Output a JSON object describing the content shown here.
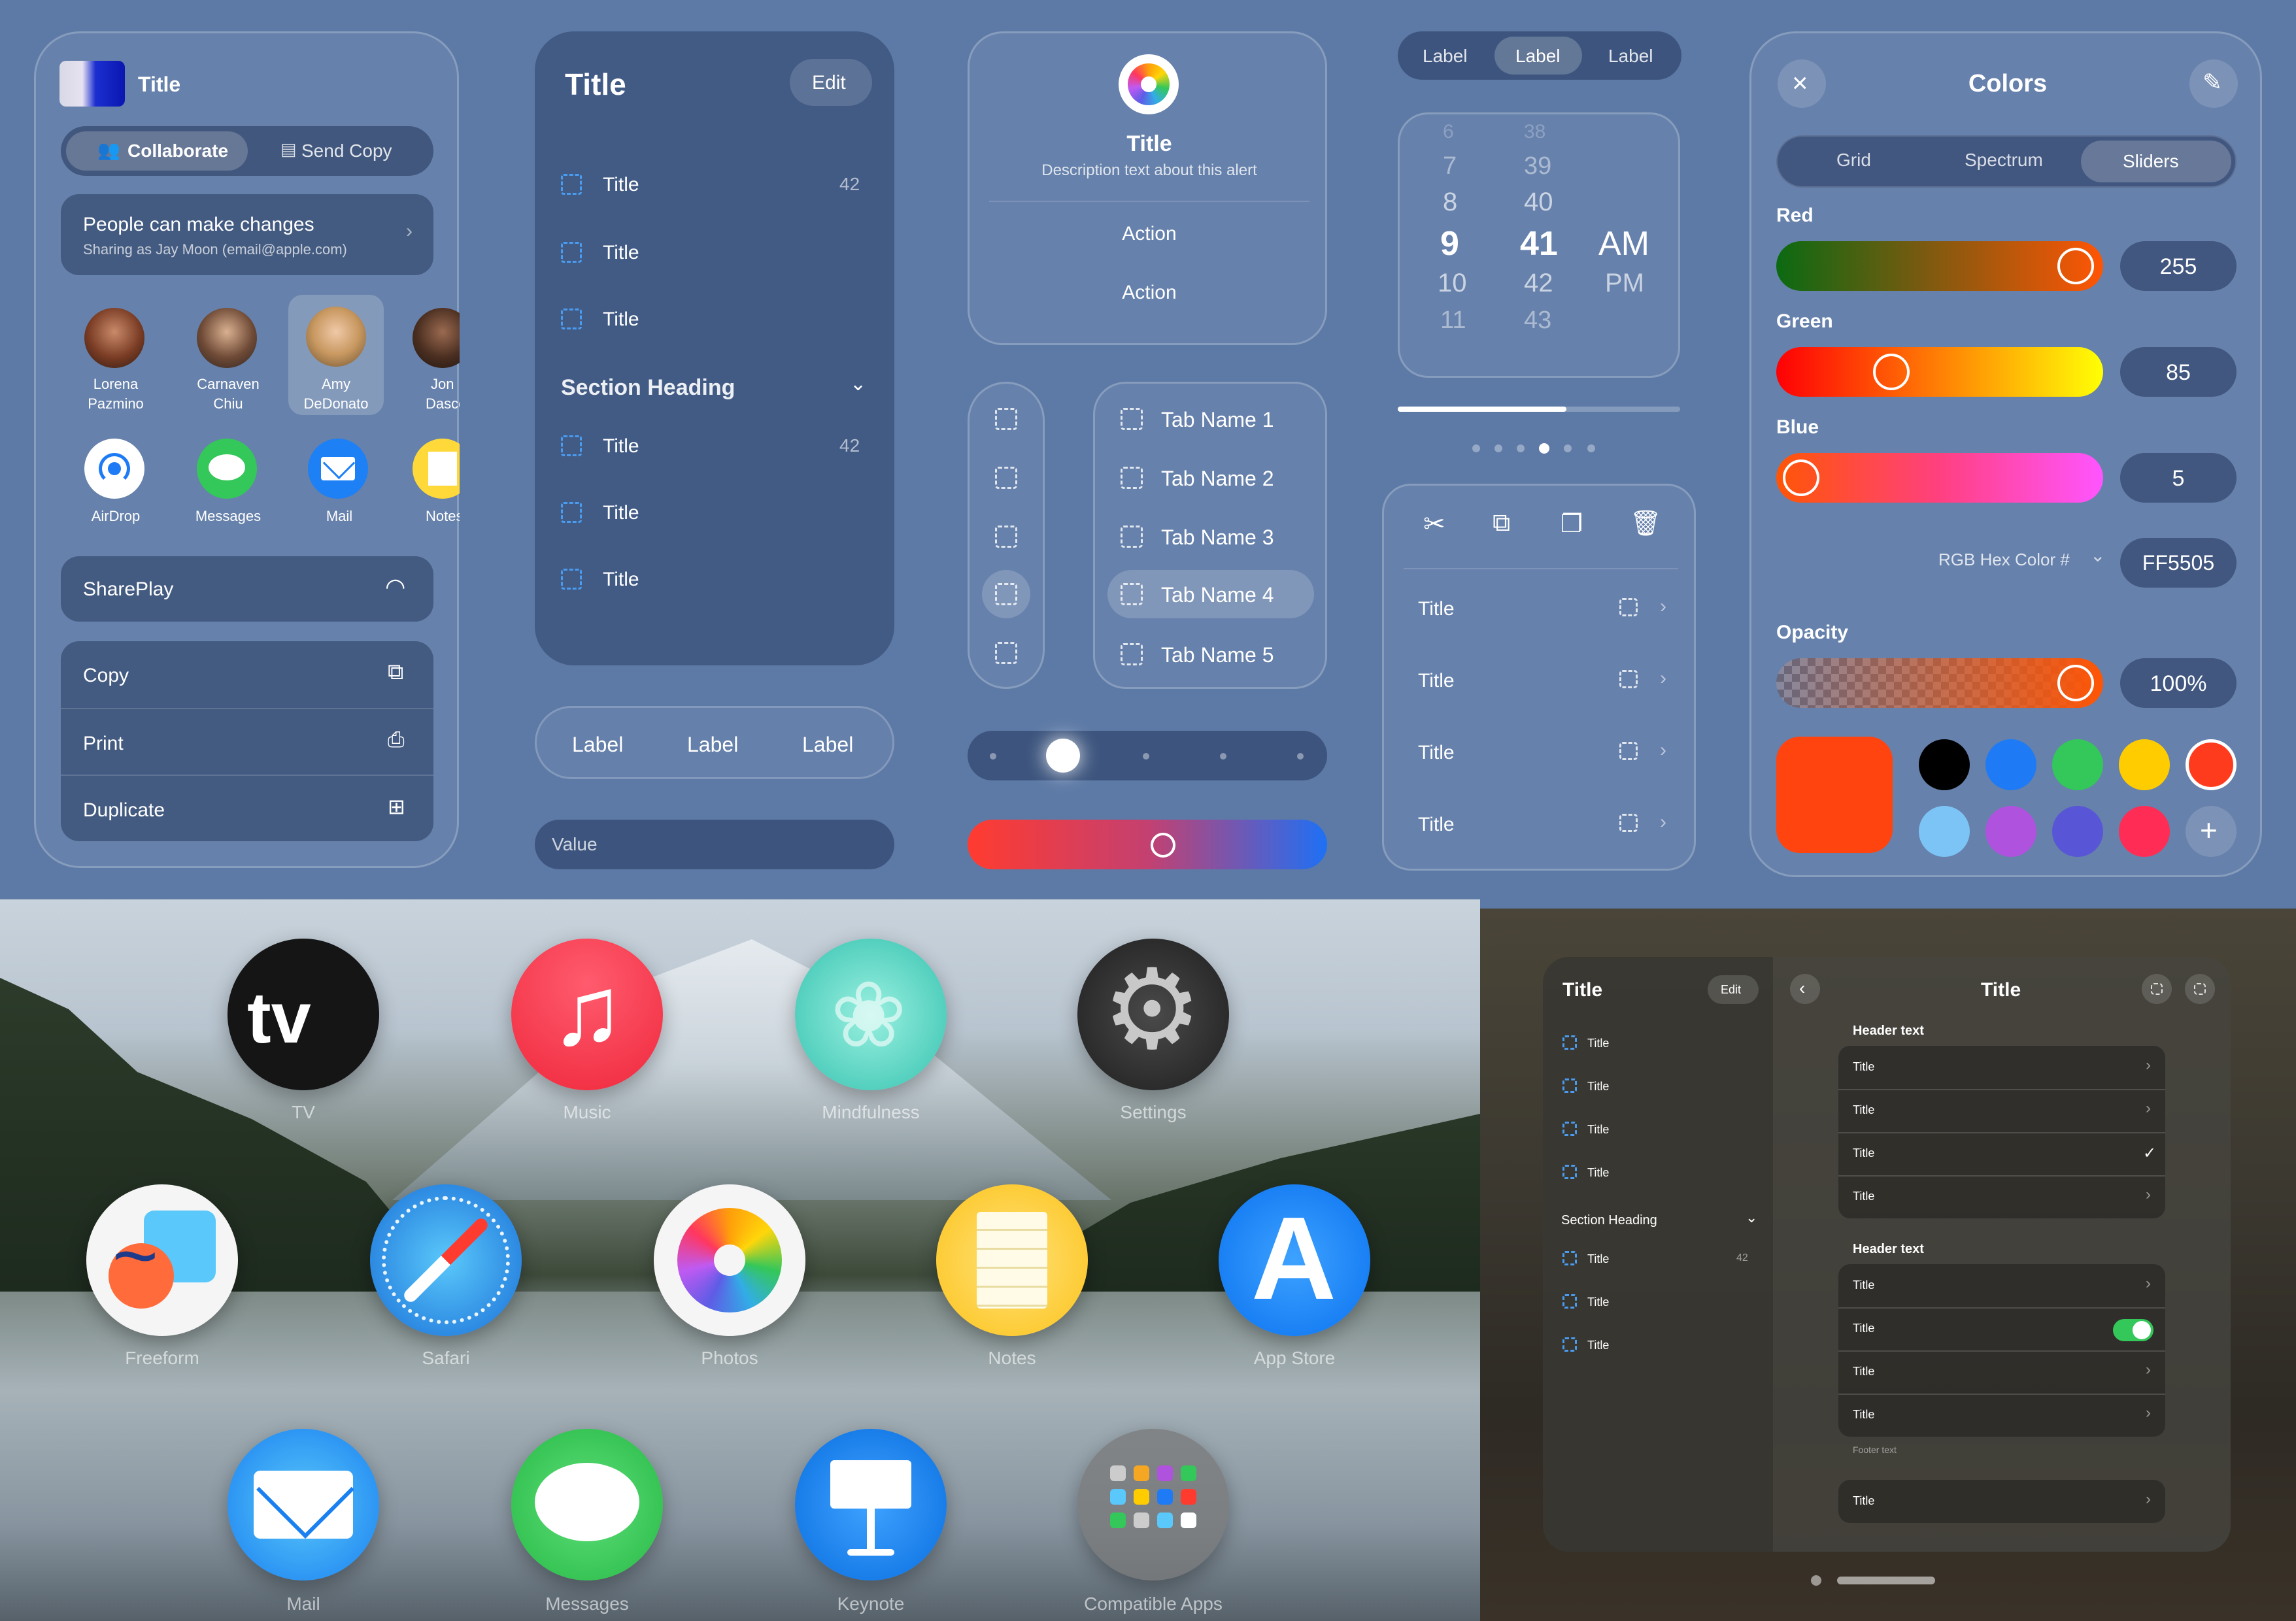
{
  "share": {
    "title": "Title",
    "collaborate": "Collaborate",
    "send_copy": "Send Copy",
    "permission_title": "People can make changes",
    "permission_sub": "Sharing as Jay Moon (email@apple.com)",
    "people": [
      {
        "line1": "Lorena",
        "line2": "Pazmino"
      },
      {
        "line1": "Carnaven",
        "line2": "Chiu"
      },
      {
        "line1": "Amy",
        "line2": "DeDonato"
      },
      {
        "line1": "Jon",
        "line2": "Dasco"
      }
    ],
    "apps": [
      "AirDrop",
      "Messages",
      "Mail",
      "Notes"
    ],
    "shareplay": "SharePlay",
    "actions": [
      "Copy",
      "Print",
      "Duplicate"
    ]
  },
  "list": {
    "title": "Title",
    "edit": "Edit",
    "rows": [
      "Title",
      "Title",
      "Title"
    ],
    "count": "42",
    "section": "Section Heading",
    "rows2": [
      "Title",
      "Title",
      "Title"
    ],
    "count2": "42"
  },
  "segmented_labels": [
    "Label",
    "Label",
    "Label"
  ],
  "value_field": "Value",
  "alert": {
    "title": "Title",
    "description": "Description text about this alert",
    "action1": "Action",
    "action2": "Action"
  },
  "tabs": [
    "Tab Name 1",
    "Tab Name 2",
    "Tab Name 3",
    "Tab Name 4",
    "Tab Name 5"
  ],
  "top_segment": [
    "Label",
    "Label",
    "Label"
  ],
  "picker": {
    "hours": [
      "7",
      "8",
      "9",
      "10",
      "11"
    ],
    "minutes": [
      "39",
      "40",
      "41",
      "42",
      "43"
    ],
    "ampm": [
      "AM",
      "PM"
    ]
  },
  "menu_rows": [
    "Title",
    "Title",
    "Title",
    "Title"
  ],
  "colors": {
    "title": "Colors",
    "tabs": [
      "Grid",
      "Spectrum",
      "Sliders"
    ],
    "red_label": "Red",
    "red_value": "255",
    "green_label": "Green",
    "green_value": "85",
    "blue_label": "Blue",
    "blue_value": "5",
    "hex_label": "RGB Hex Color #",
    "hex_value": "FF5505",
    "opacity_label": "Opacity",
    "opacity_value": "100%",
    "current_color": "#ff4410",
    "swatches": [
      "#000000",
      "#1e7bf5",
      "#34c759",
      "#ffcc00",
      "#ff3b1e",
      "#7cc4f5",
      "#af52de",
      "#5856d6",
      "#ff2d55"
    ]
  },
  "home_apps": [
    {
      "label": "TV"
    },
    {
      "label": "Music"
    },
    {
      "label": "Mindfulness"
    },
    {
      "label": "Settings"
    },
    {
      "label": "Freeform"
    },
    {
      "label": "Safari"
    },
    {
      "label": "Photos"
    },
    {
      "label": "Notes"
    },
    {
      "label": "App Store"
    },
    {
      "label": "Mail"
    },
    {
      "label": "Messages"
    },
    {
      "label": "Keynote"
    },
    {
      "label": "Compatible Apps"
    }
  ],
  "window": {
    "sidebar_title": "Title",
    "edit": "Edit",
    "sidebar_rows": [
      "Title",
      "Title",
      "Title",
      "Title"
    ],
    "section": "Section Heading",
    "sidebar_rows2": [
      "Title",
      "Title",
      "Title"
    ],
    "count": "42",
    "main_title": "Title",
    "header1": "Header text",
    "group1": [
      "Title",
      "Title",
      "Title",
      "Title"
    ],
    "header2": "Header text",
    "group2": [
      "Title",
      "Title",
      "Title",
      "Title"
    ],
    "footer": "Footer text",
    "last_row": "Title"
  }
}
